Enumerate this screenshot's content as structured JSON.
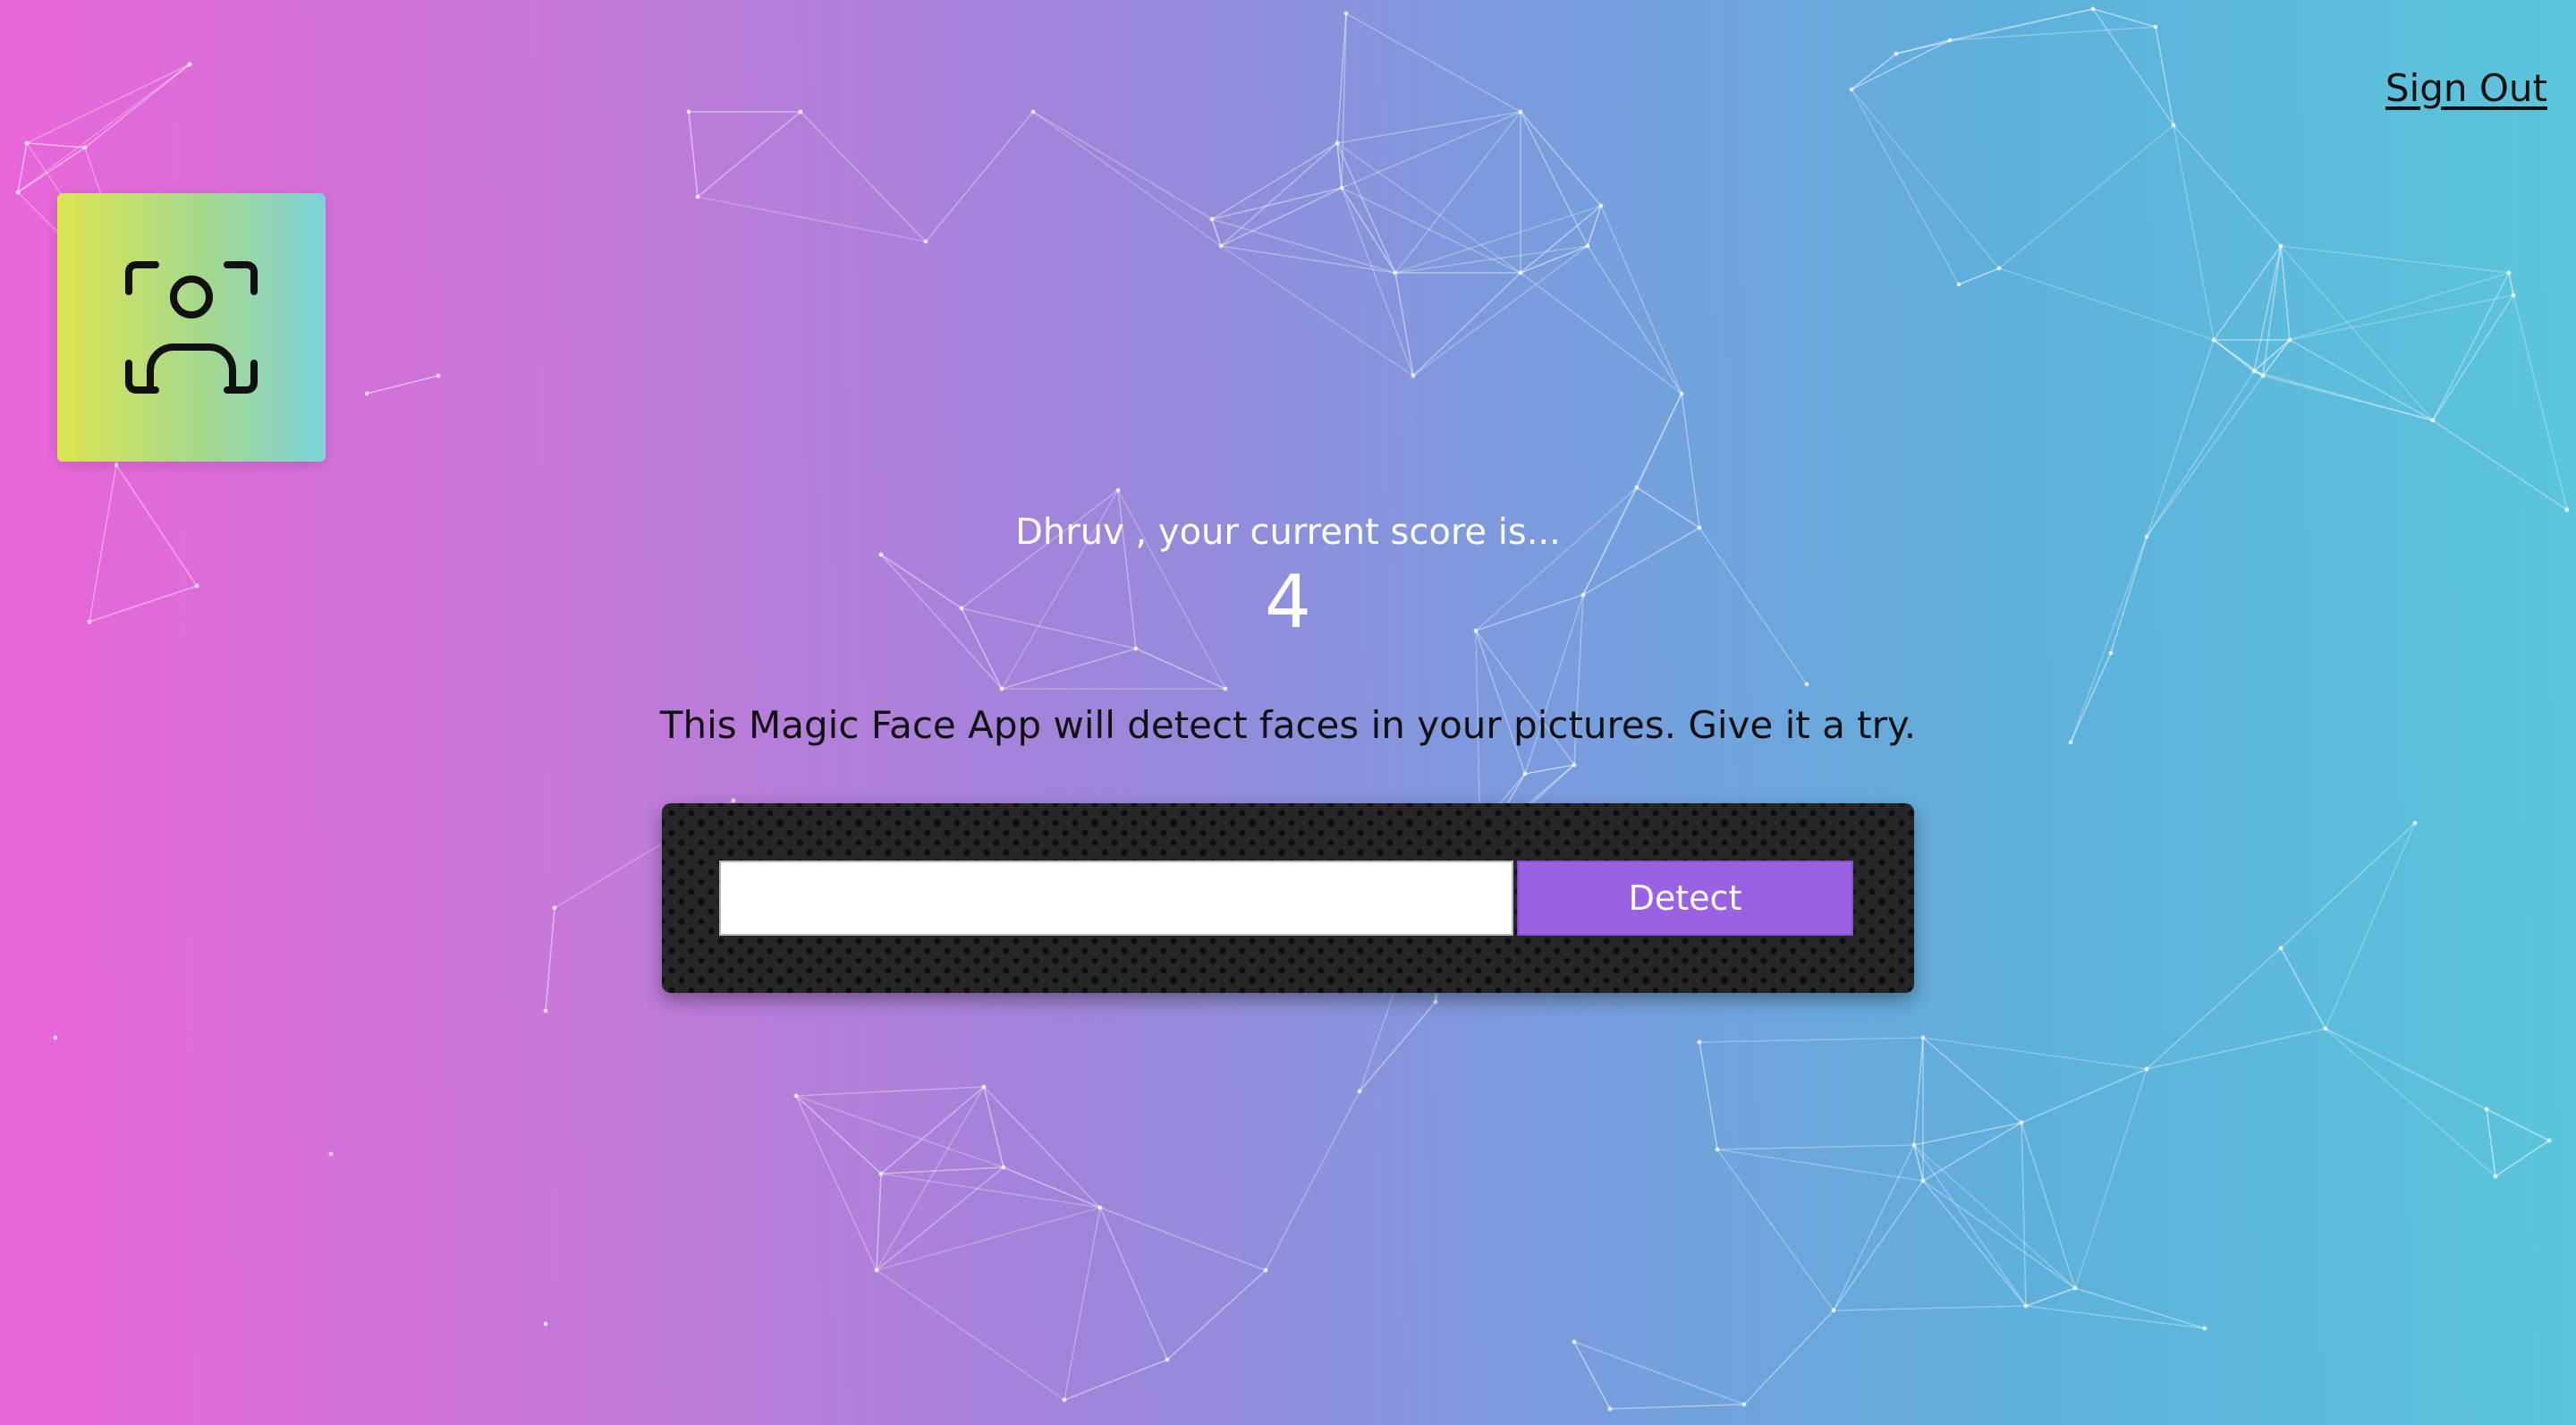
{
  "navigation": {
    "sign_out_label": "Sign Out"
  },
  "logo": {
    "icon": "face-scan-icon"
  },
  "rank": {
    "message": "Dhruv , your current score is...",
    "value": "4"
  },
  "description": "This Magic Face App will detect faces in your pictures. Give it a try.",
  "image_form": {
    "input_value": "",
    "input_placeholder": "",
    "detect_label": "Detect"
  },
  "colors": {
    "button": "#9a61e3",
    "panel": "#262626",
    "gradient_left": "#ea65d9",
    "gradient_right": "#5bc6db"
  }
}
